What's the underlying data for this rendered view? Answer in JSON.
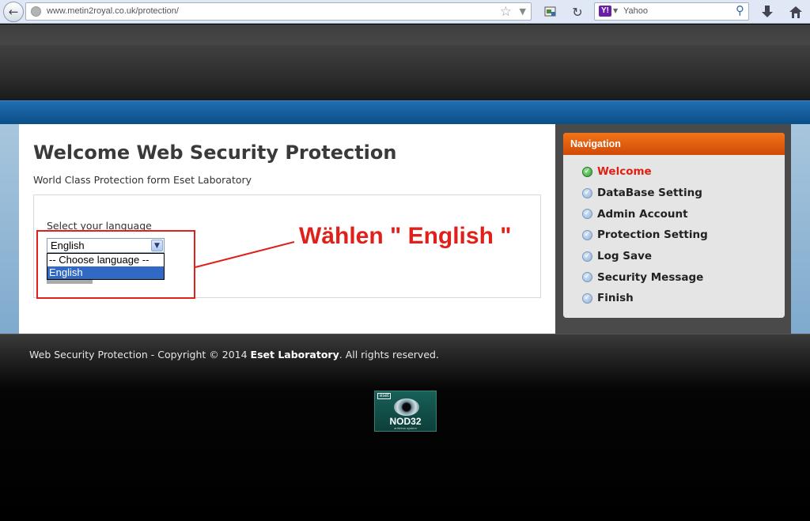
{
  "browser": {
    "url_host": "www.metin2royal.co.uk",
    "url_path": "/protection/",
    "search_engine": "Yahoo",
    "search_logo_text": "Y!"
  },
  "main": {
    "title": "Welcome Web Security Protection",
    "subtitle": "World Class Protection form Eset Laboratory",
    "language_label": "Select your language",
    "language_selected": "English",
    "language_options": [
      "-- Choose language --",
      "English"
    ]
  },
  "annotation": {
    "text": "Wählen \" English \"",
    "color": "#e0201b"
  },
  "navigation": {
    "title": "Navigation",
    "items": [
      {
        "label": "Welcome",
        "active": true
      },
      {
        "label": "DataBase Setting",
        "active": false
      },
      {
        "label": "Admin Account",
        "active": false
      },
      {
        "label": "Protection Setting",
        "active": false
      },
      {
        "label": "Log Save",
        "active": false
      },
      {
        "label": "Security Message",
        "active": false
      },
      {
        "label": "Finish",
        "active": false
      }
    ]
  },
  "footer": {
    "prefix": "Web Security Protection - Copyright © 2014 ",
    "brand": "Eset Laboratory",
    "suffix": ". All rights reserved.",
    "logo_tag": "eset",
    "logo_name": "NOD32",
    "logo_sub": "antivirus system"
  },
  "colors": {
    "accent_orange": "#e8620f",
    "header_blue": "#11588f",
    "active_nav": "#e02010"
  }
}
